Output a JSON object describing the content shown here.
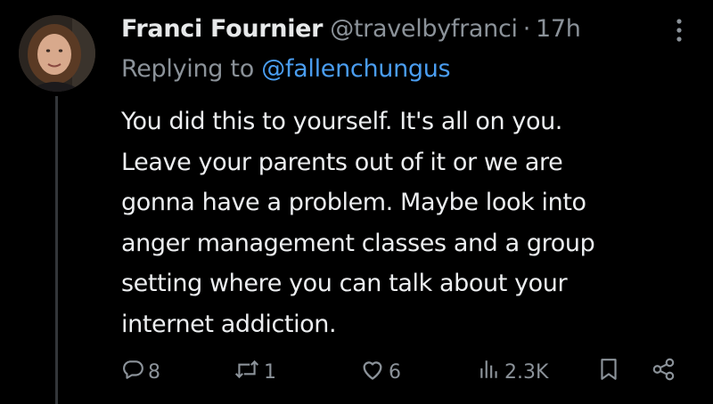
{
  "tweet": {
    "display_name": "Franci Fournier",
    "handle": "@travelbyfranci",
    "separator": "·",
    "time": "17h",
    "reply_prefix": "Replying to",
    "reply_target": "@fallenchungus",
    "body_lines": [
      "You did this to yourself. It's all on you.",
      "Leave your parents out of it or we are",
      "gonna have a problem. Maybe look into",
      "anger management classes and a group",
      "setting where you can talk about your",
      "internet addiction."
    ],
    "actions": {
      "replies": "8",
      "retweets": "1",
      "likes": "6",
      "views": "2.3K"
    }
  },
  "icons": {
    "more": "more-vertical-icon",
    "reply": "reply-bubble-icon",
    "retweet": "retweet-icon",
    "like": "heart-icon",
    "views": "views-bar-icon",
    "bookmark": "bookmark-icon",
    "share": "share-icon"
  },
  "colors": {
    "background": "#000000",
    "text": "#e7e9ea",
    "muted": "#8b9299",
    "link": "#4a9df0",
    "thread_line": "#333639"
  }
}
